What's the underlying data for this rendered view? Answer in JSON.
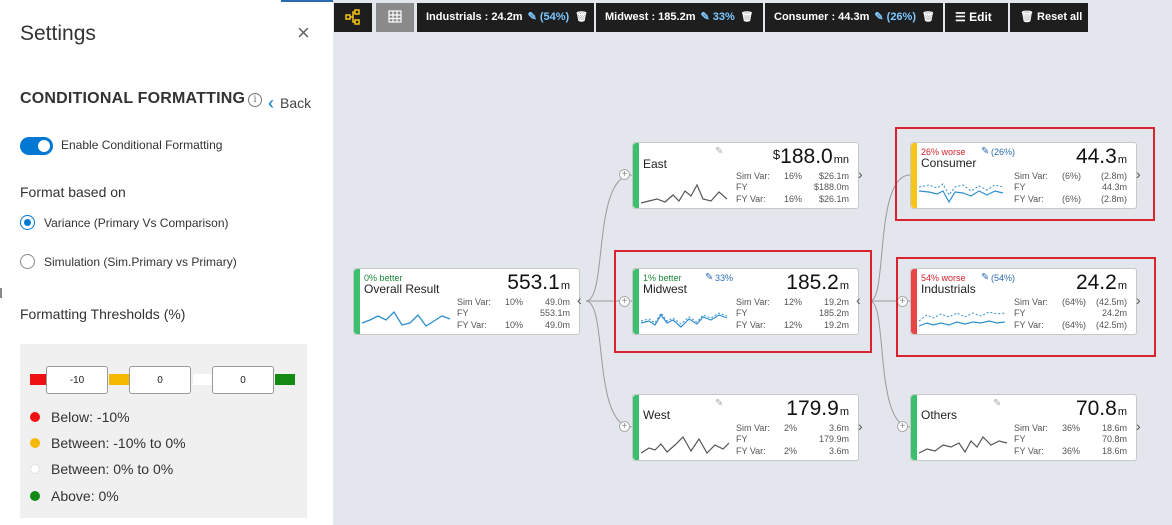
{
  "settings": {
    "title": "Settings",
    "close": "×",
    "section_title": "CONDITIONAL FORMATTING",
    "info": "i",
    "back": "Back",
    "toggle_label": "Enable Conditional Formatting",
    "toggle_on": true,
    "format_based_on": "Format based on",
    "options": [
      {
        "label": "Variance (Primary Vs Comparison)",
        "selected": true
      },
      {
        "label": "Simulation (Sim.Primary vs Primary)",
        "selected": false
      }
    ],
    "thresholds_label": "Formatting Thresholds (%)",
    "threshold_values": [
      "-10",
      "0",
      "0"
    ],
    "legend": [
      {
        "label": "Below: -10%",
        "color": "#ee1111"
      },
      {
        "label": "Between: -10% to 0%",
        "color": "#f5b800"
      },
      {
        "label": "Between: 0% to 0%",
        "color": "#ffffff"
      },
      {
        "label": "Above: 0%",
        "color": "#138a13"
      }
    ]
  },
  "toolbar": {
    "filters": [
      {
        "label": "Industrials : 24.2m",
        "pct": "(54%)"
      },
      {
        "label": "Midwest : 185.2m",
        "pct": "33%"
      },
      {
        "label": "Consumer : 44.3m",
        "pct": "(26%)"
      }
    ],
    "edit": "Edit",
    "reset": "Reset all"
  },
  "stat_labels": {
    "sim": "Sim Var:",
    "fy": "FY",
    "fyv": "FY Var:"
  },
  "nodes": {
    "overall": {
      "name": "Overall Result",
      "tag": "0% better",
      "value": "553.1",
      "unit": "m",
      "sim_pct": "10%",
      "sim_val": "49.0m",
      "fy_val": "553.1m",
      "fyv_pct": "10%",
      "fyv_val": "49.0m"
    },
    "east": {
      "name": "East",
      "currency": "$",
      "value": "188.0",
      "unit": "mn",
      "sim_pct": "16%",
      "sim_val": "$26.1m",
      "fy_val": "$188.0m",
      "fyv_pct": "16%",
      "fyv_val": "$26.1m"
    },
    "midwest": {
      "name": "Midwest",
      "tag": "1% better",
      "tag_pct": "33%",
      "value": "185.2",
      "unit": "m",
      "sim_pct": "12%",
      "sim_val": "19.2m",
      "fy_val": "185.2m",
      "fyv_pct": "12%",
      "fyv_val": "19.2m"
    },
    "west": {
      "name": "West",
      "value": "179.9",
      "unit": "m",
      "sim_pct": "2%",
      "sim_val": "3.6m",
      "fy_val": "179.9m",
      "fyv_pct": "2%",
      "fyv_val": "3.6m"
    },
    "consumer": {
      "name": "Consumer",
      "tag": "26% worse",
      "tag_pct": "(26%)",
      "value": "44.3",
      "unit": "m",
      "sim_pct": "(6%)",
      "sim_val": "(2.8m)",
      "fy_val": "44.3m",
      "fyv_pct": "(6%)",
      "fyv_val": "(2.8m)"
    },
    "industrials": {
      "name": "Industrials",
      "tag": "54% worse",
      "tag_pct": "(54%)",
      "value": "24.2",
      "unit": "m",
      "sim_pct": "(64%)",
      "sim_val": "(42.5m)",
      "fy_val": "24.2m",
      "fyv_pct": "(64%)",
      "fyv_val": "(42.5m)"
    },
    "others": {
      "name": "Others",
      "value": "70.8",
      "unit": "m",
      "sim_pct": "36%",
      "sim_val": "18.6m",
      "fy_val": "70.8m",
      "fyv_pct": "36%",
      "fyv_val": "18.6m"
    }
  },
  "colors": {
    "positive": "#3cbf6e",
    "warning": "#f5c518",
    "negative": "#e84545",
    "highlight": "#d9232d",
    "accent": "#0078d4"
  }
}
